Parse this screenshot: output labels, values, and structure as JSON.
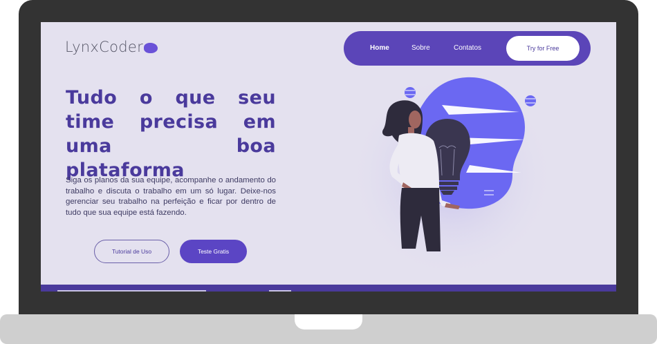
{
  "brand": {
    "name": "LynxCoder"
  },
  "nav": {
    "items": [
      "Home",
      "Sobre",
      "Contatos"
    ],
    "active": "Home",
    "cta_label": "Try for Free"
  },
  "hero": {
    "headline": "Tudo o que seu time precisa em uma boa plataforma",
    "body": "Siga os planos da sua equipe, acompanhe o andamento do trabalho e discuta o trabalho em um só lugar. Deixe-nos gerenciar seu trabalho na perfeição e ficar por dentro de tudo que sua equipe está fazendo.",
    "secondary_button": "Tutorial de Uso",
    "primary_button": "Teste Gratis"
  },
  "illustration": {
    "subject": "woman-with-lightbulb",
    "icons": [
      "woman-icon",
      "lightbulb-icon"
    ]
  },
  "colors": {
    "brand_purple": "#4a3a9c",
    "nav_purple": "#5b45b8",
    "accent_blue": "#6b68f2",
    "screen_bg": "#e4e1ef",
    "laptop_frame": "#333333"
  }
}
